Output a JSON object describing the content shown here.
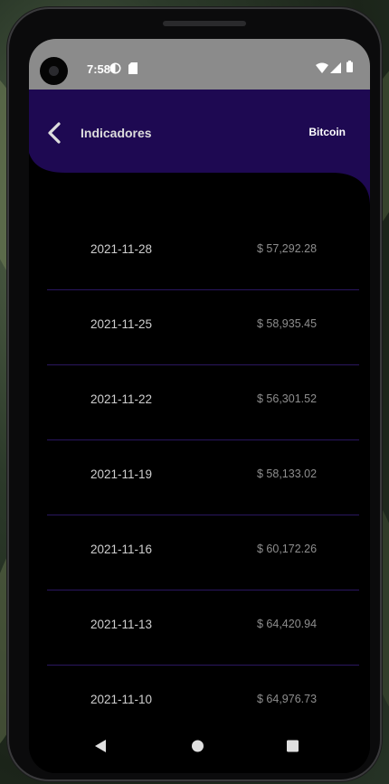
{
  "status_bar": {
    "time": "7:58"
  },
  "app_bar": {
    "title": "Indicadores",
    "right_label": "Bitcoin",
    "color": "#1e0952"
  },
  "rows": [
    {
      "date": "2021-11-28",
      "price": "$ 57,292.28"
    },
    {
      "date": "2021-11-25",
      "price": "$ 58,935.45"
    },
    {
      "date": "2021-11-22",
      "price": "$ 56,301.52"
    },
    {
      "date": "2021-11-19",
      "price": "$ 58,133.02"
    },
    {
      "date": "2021-11-16",
      "price": "$ 60,172.26"
    },
    {
      "date": "2021-11-13",
      "price": "$ 64,420.94"
    },
    {
      "date": "2021-11-10",
      "price": "$ 64,976.73"
    }
  ],
  "icons": {
    "back": "chevron-left-icon",
    "nav_back": "triangle-back-icon",
    "nav_home": "circle-home-icon",
    "nav_recents": "square-recents-icon"
  }
}
